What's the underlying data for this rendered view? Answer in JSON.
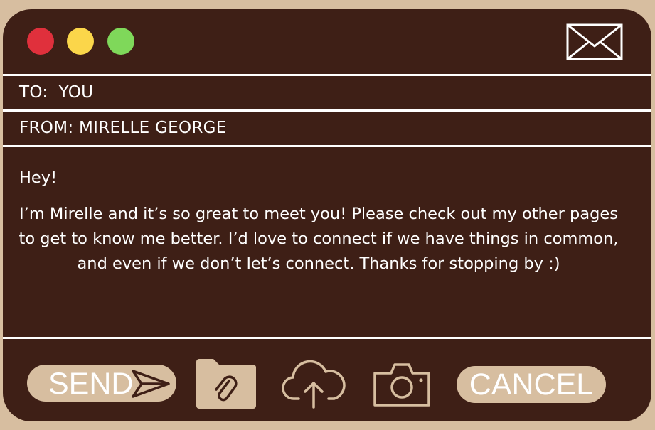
{
  "window": {
    "controls": [
      "close",
      "minimize",
      "maximize"
    ],
    "icon": "envelope-icon"
  },
  "header": {
    "to_line": "TO:  YOU",
    "from_line": "FROM: MIRELLE GEORGE"
  },
  "message": {
    "greeting": "Hey!",
    "body": "I’m Mirelle and it’s so great to meet you! Please check out my other pages  to get to know me better. I’d love to connect if we have things in common, and even if we don’t let’s connect. Thanks for stopping by :)"
  },
  "toolbar": {
    "send_label": "SEND",
    "send_icon": "paper-plane-icon",
    "attach_icon": "folder-paperclip-icon",
    "upload_icon": "cloud-upload-icon",
    "camera_icon": "camera-icon",
    "cancel_label": "CANCEL"
  },
  "colors": {
    "page_background": "#d7bea0",
    "window_background": "#3e1f16",
    "accent": "#d7bea0",
    "close": "#e0303c",
    "minimize": "#fbd64a",
    "maximize": "#7fd85a"
  }
}
